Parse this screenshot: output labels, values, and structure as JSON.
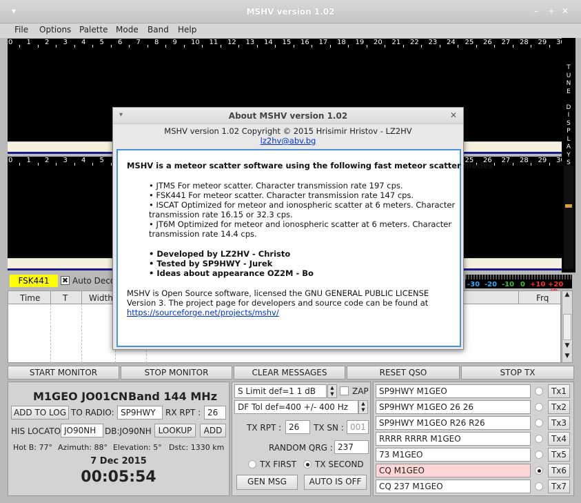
{
  "window": {
    "title": "MSHV version 1.02"
  },
  "menu": [
    "File",
    "Options",
    "Palette",
    "Mode",
    "Band",
    "Help"
  ],
  "scale_labels": [
    "0",
    "1",
    "2",
    "3",
    "4",
    "5",
    "6",
    "7",
    "8",
    "9",
    "10",
    "11",
    "12",
    "13",
    "14",
    "15",
    "16",
    "17",
    "18",
    "19",
    "20",
    "21",
    "22",
    "23",
    "24",
    "25",
    "26",
    "27",
    "28",
    "29",
    "30"
  ],
  "tune_display": "TUNE DISPLAYS",
  "mode": {
    "current": "FSK441",
    "auto_decode_label": "Auto Deco"
  },
  "meter": [
    "-30",
    "-20",
    "-10",
    "0",
    "+10",
    "+20 dB"
  ],
  "table": {
    "headers": [
      "Time",
      "T",
      "Width",
      "Frq"
    ]
  },
  "buttons": {
    "start_monitor": "START MONITOR",
    "stop_monitor": "STOP MONITOR",
    "clear_messages": "CLEAR MESSAGES",
    "reset_qso": "RESET QSO",
    "stop_tx": "STOP TX"
  },
  "station": {
    "header": "M1GEO JO01CN",
    "band": "Band 144 MHz",
    "add_to_log": "ADD TO LOG",
    "to_radio_label": "TO RADIO:",
    "to_radio": "SP9HWY",
    "rx_rpt_label": "RX RPT :",
    "rx_rpt": "26",
    "his_locator_label": "HIS LOCATO",
    "his_locator": "JO90NH",
    "db_label": "DB:JO90NH",
    "lookup": "LOOKUP",
    "add": "ADD",
    "hot_b": "Hot B: 77°",
    "azimuth": "Azimuth:  88°",
    "elevation": "Elevation:  5°",
    "dstc": "Dstc:  1330 km",
    "date": "7 Dec 2015",
    "time": "00:05:54"
  },
  "controls": {
    "s_limit": "S Limit def=1  1  dB",
    "zap": "ZAP",
    "df_tol": "DF Tol def=400 +/-  400  Hz",
    "tx_rpt_label": "TX RPT :",
    "tx_rpt": "26",
    "tx_sn_label": "TX SN :",
    "tx_sn": "001",
    "random_qrg_label": "RANDOM QRG :",
    "random_qrg": "237",
    "tx_first": "TX FIRST",
    "tx_second": "TX SECOND",
    "gen_msg": "GEN MSG",
    "auto_is_off": "AUTO IS OFF"
  },
  "tx_messages": [
    {
      "text": "SP9HWY M1GEO",
      "btn": "Tx1"
    },
    {
      "text": "SP9HWY M1GEO 26 26",
      "btn": "Tx2"
    },
    {
      "text": "SP9HWY M1GEO R26 R26",
      "btn": "Tx3"
    },
    {
      "text": "RRRR RRRR M1GEO",
      "btn": "Tx4"
    },
    {
      "text": "73 M1GEO",
      "btn": "Tx5"
    },
    {
      "text": "CQ M1GEO",
      "btn": "Tx6"
    },
    {
      "text": "CQ 237 M1GEO",
      "btn": "Tx7"
    }
  ],
  "about": {
    "title": "About MSHV version 1.02",
    "copyright": "MSHV version 1.02 Copyright © 2015 Hrisimir Hristov - LZ2HV",
    "email": "lz2hv@abv.bg",
    "heading": "MSHV is a meteor scatter software using the following fast meteor scatter modes",
    "modes": [
      "• JTMS For meteor scatter. Character transmission rate 197 cps.",
      "• FSK441 For meteor scatter. Character transmission rate 147 cps.",
      "• ISCAT Optimized for meteor and ionospheric scatter at 6 meters. Character",
      "   transmission rate 16.15 or 32.3 cps.",
      "• JT6M Optimized for meteor and ionospheric scatter at 6 meters. Character",
      "   transmission rate 14.4 cps."
    ],
    "credits": [
      "• Developed by LZ2HV - Christo",
      "• Tested by SP9HWY - Jurek",
      "• Ideas about appearance OZ2M - Bo"
    ],
    "license1": "MSHV is Open Source software, licensed the GNU GENERAL PUBLIC LICENSE",
    "license2": "Version 3. The project page for developers and source code can be found at",
    "project_url": "https://sourceforge.net/projects/mshv/"
  }
}
